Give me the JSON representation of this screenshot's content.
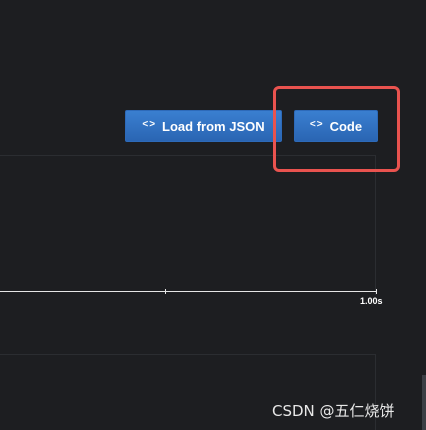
{
  "toolbar": {
    "load_json": {
      "icon": "<>",
      "label": "Load from JSON"
    },
    "code": {
      "icon": "<>",
      "label": "Code"
    }
  },
  "timeline": {
    "end_tick_label": "1.00s"
  },
  "watermark": {
    "text": "CSDN @五仁烧饼"
  },
  "colors": {
    "background": "#1d1e21",
    "button": "#2f6fc2",
    "highlight": "#e9534f",
    "axis": "#e6e6e6"
  }
}
